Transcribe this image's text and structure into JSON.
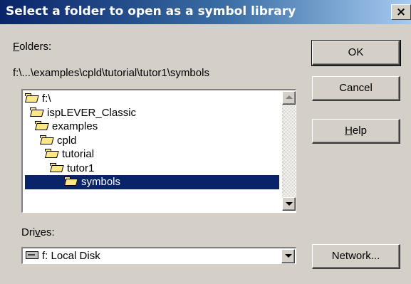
{
  "window": {
    "title": "Select a folder to open as a symbol library",
    "close_glyph": "×"
  },
  "folders": {
    "label_mnemonic": "F",
    "label_rest": "olders:",
    "current_path": "f:\\...\\examples\\cpld\\tutorial\\tutor1\\symbols",
    "tree": [
      {
        "label": "f:\\",
        "icon": "open-folder-icon",
        "selected": false
      },
      {
        "label": "ispLEVER_Classic",
        "icon": "open-folder-icon",
        "selected": false
      },
      {
        "label": "examples",
        "icon": "open-folder-icon",
        "selected": false
      },
      {
        "label": "cpld",
        "icon": "open-folder-icon",
        "selected": false
      },
      {
        "label": "tutorial",
        "icon": "open-folder-icon",
        "selected": false
      },
      {
        "label": "tutor1",
        "icon": "open-folder-icon",
        "selected": false
      },
      {
        "label": "symbols",
        "icon": "open-folder-icon",
        "selected": true
      }
    ]
  },
  "drives": {
    "label_before": "Dri",
    "label_mnemonic": "v",
    "label_after": "es:",
    "selected": "f: Local Disk",
    "icon": "hard-disk-icon"
  },
  "buttons": {
    "ok": "OK",
    "cancel": "Cancel",
    "help_mnemonic": "H",
    "help_rest": "elp",
    "network": "Network..."
  },
  "colors": {
    "dialog_bg": "#d4d0c8",
    "title_gradient_start": "#0a246a",
    "title_gradient_end": "#a6caf0",
    "selection_bg": "#0a246a"
  }
}
